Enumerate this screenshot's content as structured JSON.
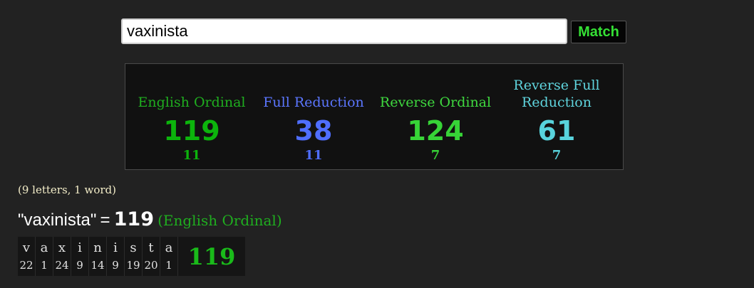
{
  "search": {
    "value": "vaxinista"
  },
  "match_button": {
    "label": "Match"
  },
  "ciphers": [
    {
      "name": "English Ordinal",
      "value": "119",
      "reduced": "11",
      "color": "#1fae1f",
      "value_color": "#0cb40c"
    },
    {
      "name": "Full Reduction",
      "value": "38",
      "reduced": "11",
      "color": "#5b76ff",
      "value_color": "#4f6eff"
    },
    {
      "name": "Reverse Ordinal",
      "value": "124",
      "reduced": "7",
      "color": "#3fd93f",
      "value_color": "#37d437"
    },
    {
      "name": "Reverse Full Reduction",
      "value": "61",
      "reduced": "7",
      "color": "#5fd4dd",
      "value_color": "#58d3dc"
    }
  ],
  "info": "(9 letters, 1 word)",
  "equation": {
    "phrase": "\"vaxinista\"",
    "sign": "=",
    "value": "119",
    "cipher": "(English Ordinal)"
  },
  "breakdown": {
    "letters": [
      {
        "letter": "v",
        "value": "22"
      },
      {
        "letter": "a",
        "value": "1"
      },
      {
        "letter": "x",
        "value": "24"
      },
      {
        "letter": "i",
        "value": "9"
      },
      {
        "letter": "n",
        "value": "14"
      },
      {
        "letter": "i",
        "value": "9"
      },
      {
        "letter": "s",
        "value": "19"
      },
      {
        "letter": "t",
        "value": "20"
      },
      {
        "letter": "a",
        "value": "1"
      }
    ],
    "total": "119"
  }
}
